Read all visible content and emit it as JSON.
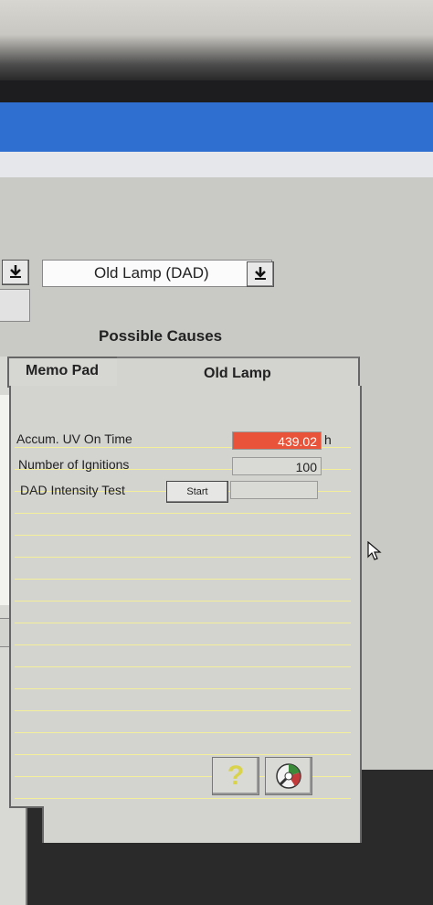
{
  "selector": {
    "selected_value": "Old Lamp (DAD)"
  },
  "section": {
    "title": "Possible Causes"
  },
  "tabs": [
    {
      "label": "Memo Pad",
      "active": false
    },
    {
      "label": "Old Lamp",
      "active": true
    }
  ],
  "rows": [
    {
      "label": "Accum. UV On Time",
      "value": "439.02",
      "unit": "h",
      "highlight_color": "#e8533a"
    },
    {
      "label": "Number of Ignitions",
      "value": "100"
    },
    {
      "label": "DAD Intensity Test",
      "button_label": "Start",
      "value": ""
    }
  ],
  "toolbar": {
    "help_glyph": "?",
    "tool_icon": "disc-tool-icon"
  },
  "colors": {
    "title_bar": "#2f6fd0",
    "warning": "#e8533a",
    "ruled_lines": "#f4ef9a"
  }
}
